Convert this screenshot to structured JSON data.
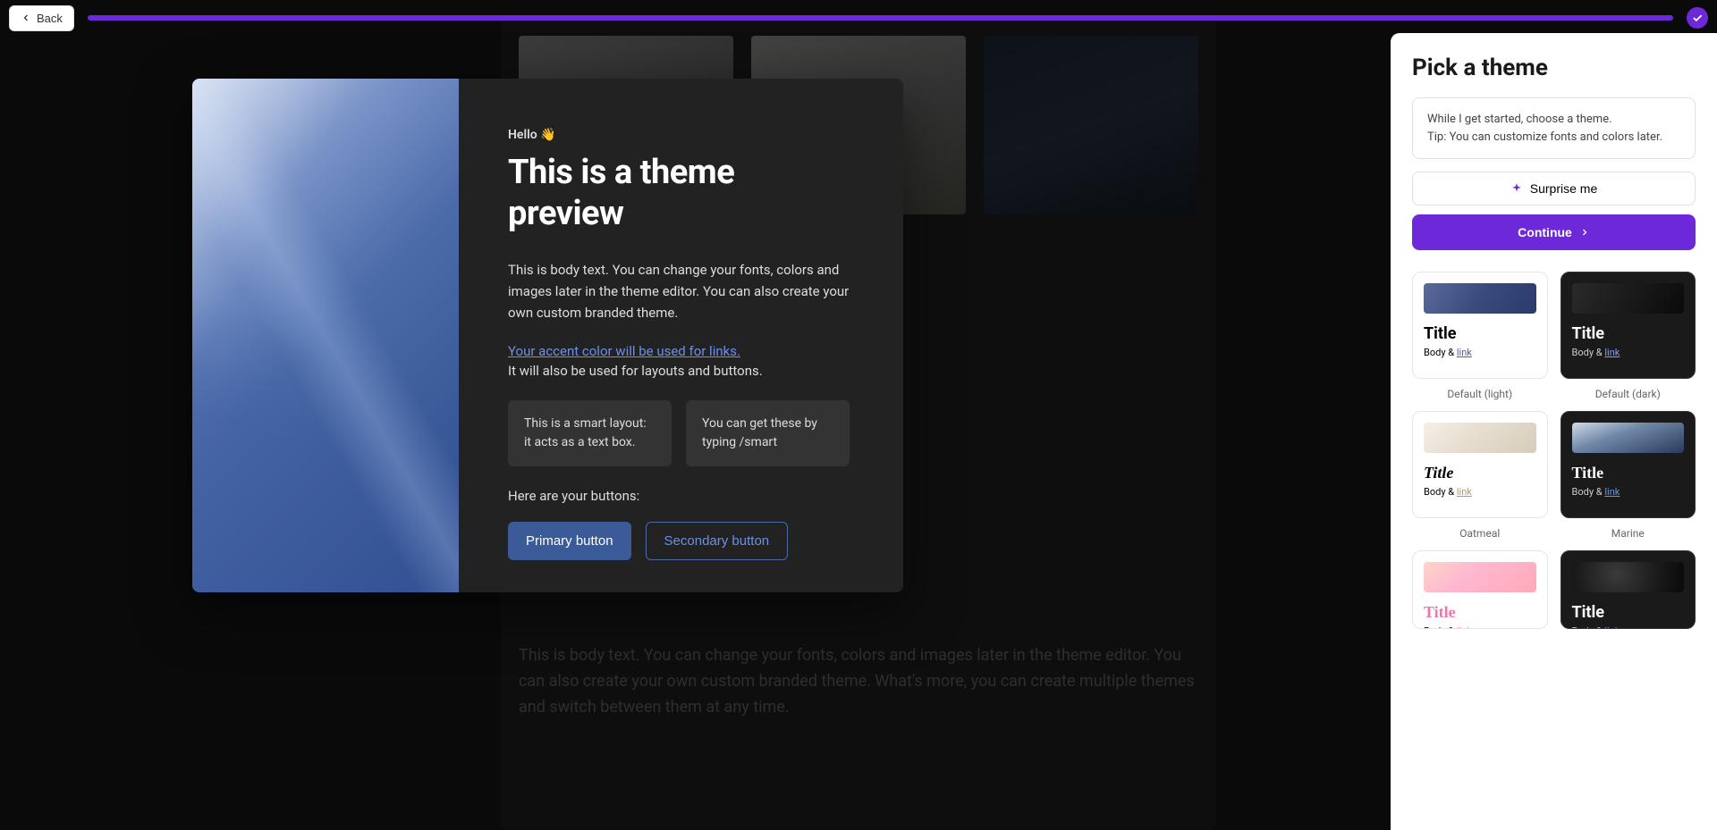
{
  "topbar": {
    "back_label": "Back"
  },
  "bg": {
    "body_text": "This is body text. You can change your fonts, colors and images later in the theme editor. You can also create your own custom branded theme. What's more, you can create multiple themes and switch between them at any time."
  },
  "modal": {
    "greeting": "Hello 👋",
    "title": "This is a theme preview",
    "body_text": "This is body text. You can change your fonts, colors and images later in the theme editor. You can also create your own custom branded theme.",
    "accent_link": "Your accent color will be used for links.",
    "accent_sub": "It will also be used for layouts and buttons.",
    "smart_box_1": "This is a smart layout: it acts as a text box.",
    "smart_box_2": "You can get these by typing /smart",
    "buttons_label": "Here are your buttons:",
    "primary_btn": "Primary button",
    "secondary_btn": "Secondary button"
  },
  "sidebar": {
    "title": "Pick a theme",
    "info_line1": "While I get started, choose a theme.",
    "info_line2": "Tip: You can customize fonts and colors later.",
    "surprise_label": "Surprise me",
    "continue_label": "Continue",
    "themes": [
      {
        "label": "Default (light)",
        "title": "Title",
        "body": "Body & ",
        "link": "link"
      },
      {
        "label": "Default (dark)",
        "title": "Title",
        "body": "Body & ",
        "link": "link"
      },
      {
        "label": "Oatmeal",
        "title": "Title",
        "body": "Body & ",
        "link": "link"
      },
      {
        "label": "Marine",
        "title": "Title",
        "body": "Body & ",
        "link": "link"
      },
      {
        "label": "",
        "title": "Title",
        "body": "Body & ",
        "link": "link"
      },
      {
        "label": "",
        "title": "Title",
        "body": "Body & ",
        "link": "link"
      }
    ]
  },
  "colors": {
    "accent": "#6d28d9",
    "modal_link": "#6c8fe8",
    "modal_primary_bg": "#3a5a98"
  }
}
